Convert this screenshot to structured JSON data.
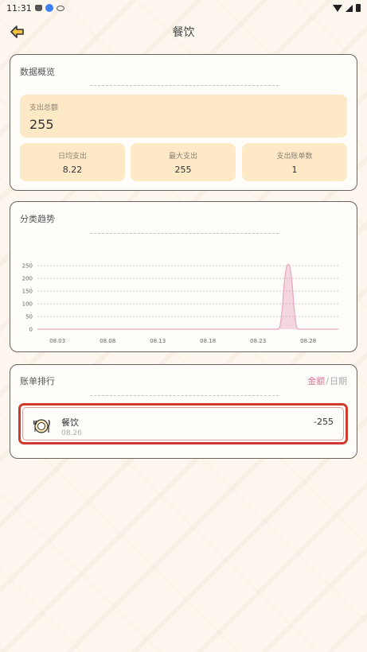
{
  "status_bar": {
    "time": "11:31"
  },
  "header": {
    "title": "餐饮"
  },
  "overview": {
    "title": "数据概览",
    "total_label": "支出总额",
    "total_value": "255",
    "stats": [
      {
        "label": "日均支出",
        "value": "8.22"
      },
      {
        "label": "最大支出",
        "value": "255"
      },
      {
        "label": "支出账单数",
        "value": "1"
      }
    ]
  },
  "trend": {
    "title": "分类趋势",
    "chart_data": {
      "type": "area",
      "title": "",
      "xlabel": "",
      "ylabel": "",
      "x_ticks": [
        "08.03",
        "08.08",
        "08.13",
        "08.18",
        "08.23",
        "08.28"
      ],
      "y_ticks": [
        0,
        50,
        100,
        150,
        200,
        250
      ],
      "ylim": [
        0,
        275
      ],
      "x_range_days": [
        1,
        31
      ],
      "series": [
        {
          "points": [
            {
              "x": 1,
              "y": 0
            },
            {
              "x": 25,
              "y": 0
            },
            {
              "x": 26,
              "y": 255
            },
            {
              "x": 27,
              "y": 0
            },
            {
              "x": 31,
              "y": 0
            }
          ]
        }
      ],
      "grid": true,
      "color": "#e7a7bf"
    }
  },
  "ranking": {
    "title": "账单排行",
    "toggle_amount": "金额",
    "toggle_sep": "/",
    "toggle_date": "日期",
    "items": [
      {
        "name": "餐饮",
        "date": "08.26",
        "amount": "-255"
      }
    ]
  },
  "colors": {
    "accent": "#e0709a",
    "highlight": "#d03a2c",
    "box": "#fde9c6"
  }
}
